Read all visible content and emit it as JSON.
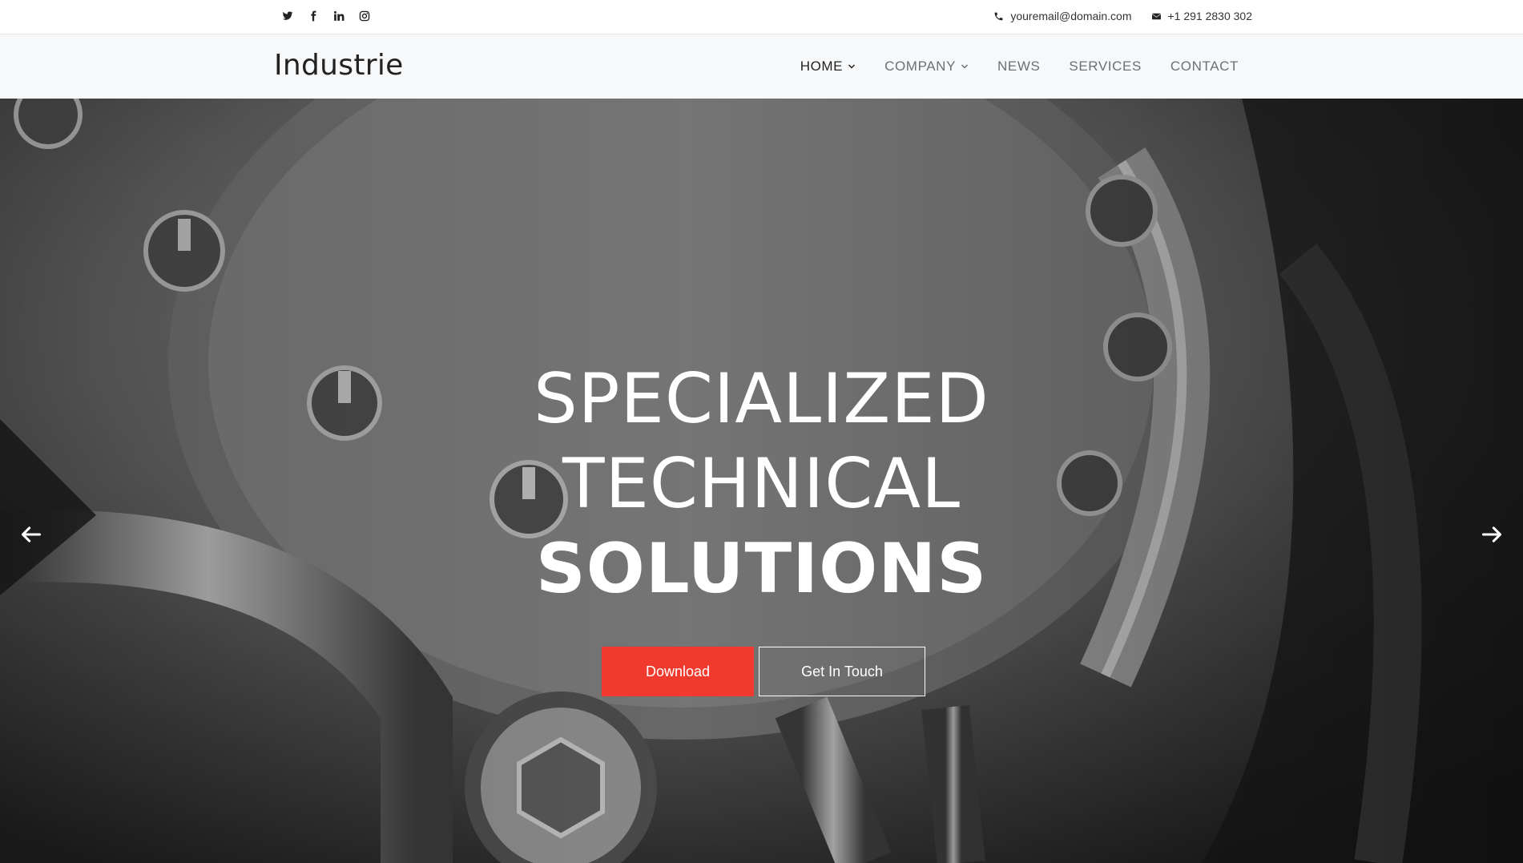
{
  "topbar": {
    "social": [
      {
        "icon": "twitter-icon"
      },
      {
        "icon": "facebook-icon"
      },
      {
        "icon": "linkedin-icon"
      },
      {
        "icon": "instagram-icon"
      }
    ],
    "email": "youremail@domain.com",
    "phone": "+1 291 2830 302"
  },
  "navbar": {
    "logo": "Industrie",
    "items": [
      {
        "label": "HOME",
        "dropdown": true,
        "active": true
      },
      {
        "label": "COMPANY",
        "dropdown": true,
        "active": false
      },
      {
        "label": "NEWS",
        "dropdown": false,
        "active": false
      },
      {
        "label": "SERVICES",
        "dropdown": false,
        "active": false
      },
      {
        "label": "CONTACT",
        "dropdown": false,
        "active": false
      }
    ]
  },
  "hero": {
    "line1": "SPECIALIZED",
    "line2": "TECHNICAL",
    "line3": "SOLUTIONS",
    "primary_button": "Download",
    "secondary_button": "Get In Touch",
    "prev_icon": "arrow-left-icon",
    "next_icon": "arrow-right-icon"
  },
  "colors": {
    "accent": "#f03a2e",
    "nav_background": "#f7f8fa",
    "text_dark": "#222222"
  }
}
